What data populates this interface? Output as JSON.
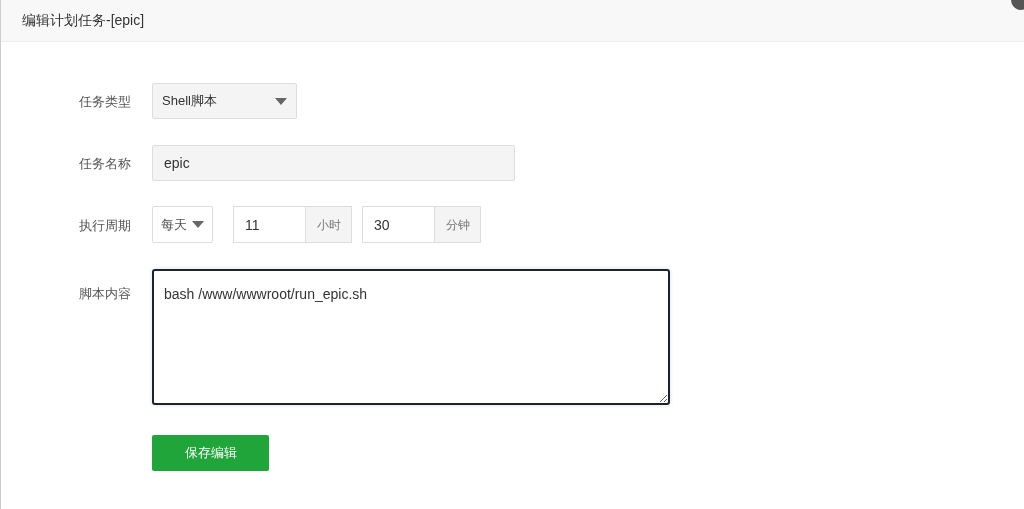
{
  "window": {
    "title": "编辑计划任务-[epic]"
  },
  "form": {
    "task_type": {
      "label": "任务类型",
      "value": "Shell脚本"
    },
    "task_name": {
      "label": "任务名称",
      "value": "epic"
    },
    "schedule": {
      "label": "执行周期",
      "period": "每天",
      "hour": "11",
      "hour_unit": "小时",
      "minute": "30",
      "minute_unit": "分钟"
    },
    "script": {
      "label": "脚本内容",
      "value": "bash /www/wwwroot/run_epic.sh"
    }
  },
  "buttons": [
    "保存编辑"
  ]
}
